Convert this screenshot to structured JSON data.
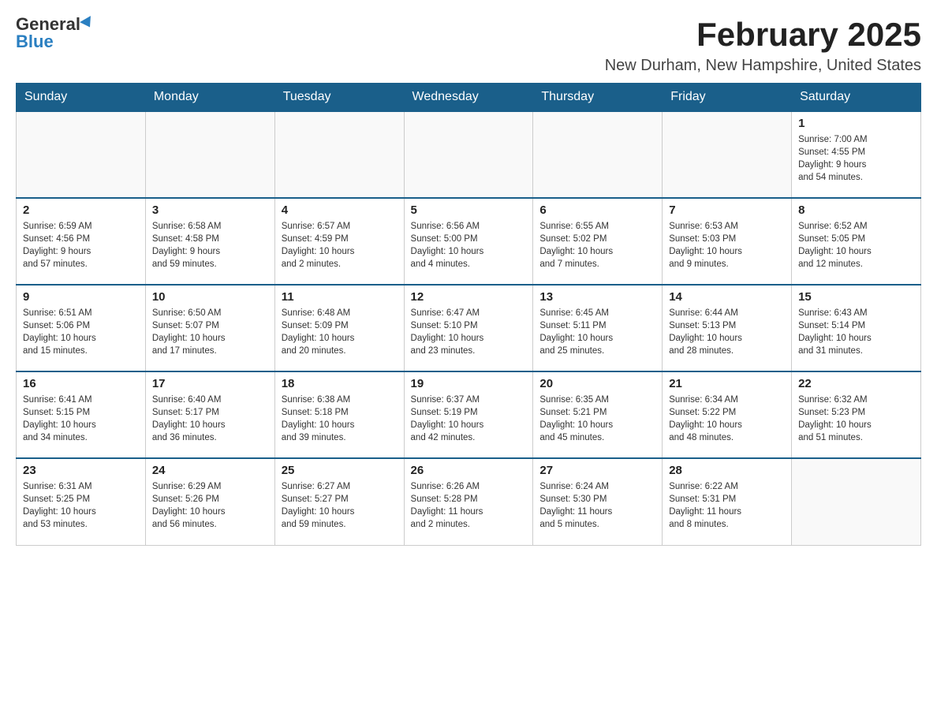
{
  "logo": {
    "general": "General",
    "blue": "Blue"
  },
  "title": "February 2025",
  "subtitle": "New Durham, New Hampshire, United States",
  "days_of_week": [
    "Sunday",
    "Monday",
    "Tuesday",
    "Wednesday",
    "Thursday",
    "Friday",
    "Saturday"
  ],
  "weeks": [
    {
      "days": [
        {
          "number": "",
          "info": "",
          "empty": true
        },
        {
          "number": "",
          "info": "",
          "empty": true
        },
        {
          "number": "",
          "info": "",
          "empty": true
        },
        {
          "number": "",
          "info": "",
          "empty": true
        },
        {
          "number": "",
          "info": "",
          "empty": true
        },
        {
          "number": "",
          "info": "",
          "empty": true
        },
        {
          "number": "1",
          "info": "Sunrise: 7:00 AM\nSunset: 4:55 PM\nDaylight: 9 hours\nand 54 minutes.",
          "empty": false
        }
      ]
    },
    {
      "days": [
        {
          "number": "2",
          "info": "Sunrise: 6:59 AM\nSunset: 4:56 PM\nDaylight: 9 hours\nand 57 minutes.",
          "empty": false
        },
        {
          "number": "3",
          "info": "Sunrise: 6:58 AM\nSunset: 4:58 PM\nDaylight: 9 hours\nand 59 minutes.",
          "empty": false
        },
        {
          "number": "4",
          "info": "Sunrise: 6:57 AM\nSunset: 4:59 PM\nDaylight: 10 hours\nand 2 minutes.",
          "empty": false
        },
        {
          "number": "5",
          "info": "Sunrise: 6:56 AM\nSunset: 5:00 PM\nDaylight: 10 hours\nand 4 minutes.",
          "empty": false
        },
        {
          "number": "6",
          "info": "Sunrise: 6:55 AM\nSunset: 5:02 PM\nDaylight: 10 hours\nand 7 minutes.",
          "empty": false
        },
        {
          "number": "7",
          "info": "Sunrise: 6:53 AM\nSunset: 5:03 PM\nDaylight: 10 hours\nand 9 minutes.",
          "empty": false
        },
        {
          "number": "8",
          "info": "Sunrise: 6:52 AM\nSunset: 5:05 PM\nDaylight: 10 hours\nand 12 minutes.",
          "empty": false
        }
      ]
    },
    {
      "days": [
        {
          "number": "9",
          "info": "Sunrise: 6:51 AM\nSunset: 5:06 PM\nDaylight: 10 hours\nand 15 minutes.",
          "empty": false
        },
        {
          "number": "10",
          "info": "Sunrise: 6:50 AM\nSunset: 5:07 PM\nDaylight: 10 hours\nand 17 minutes.",
          "empty": false
        },
        {
          "number": "11",
          "info": "Sunrise: 6:48 AM\nSunset: 5:09 PM\nDaylight: 10 hours\nand 20 minutes.",
          "empty": false
        },
        {
          "number": "12",
          "info": "Sunrise: 6:47 AM\nSunset: 5:10 PM\nDaylight: 10 hours\nand 23 minutes.",
          "empty": false
        },
        {
          "number": "13",
          "info": "Sunrise: 6:45 AM\nSunset: 5:11 PM\nDaylight: 10 hours\nand 25 minutes.",
          "empty": false
        },
        {
          "number": "14",
          "info": "Sunrise: 6:44 AM\nSunset: 5:13 PM\nDaylight: 10 hours\nand 28 minutes.",
          "empty": false
        },
        {
          "number": "15",
          "info": "Sunrise: 6:43 AM\nSunset: 5:14 PM\nDaylight: 10 hours\nand 31 minutes.",
          "empty": false
        }
      ]
    },
    {
      "days": [
        {
          "number": "16",
          "info": "Sunrise: 6:41 AM\nSunset: 5:15 PM\nDaylight: 10 hours\nand 34 minutes.",
          "empty": false
        },
        {
          "number": "17",
          "info": "Sunrise: 6:40 AM\nSunset: 5:17 PM\nDaylight: 10 hours\nand 36 minutes.",
          "empty": false
        },
        {
          "number": "18",
          "info": "Sunrise: 6:38 AM\nSunset: 5:18 PM\nDaylight: 10 hours\nand 39 minutes.",
          "empty": false
        },
        {
          "number": "19",
          "info": "Sunrise: 6:37 AM\nSunset: 5:19 PM\nDaylight: 10 hours\nand 42 minutes.",
          "empty": false
        },
        {
          "number": "20",
          "info": "Sunrise: 6:35 AM\nSunset: 5:21 PM\nDaylight: 10 hours\nand 45 minutes.",
          "empty": false
        },
        {
          "number": "21",
          "info": "Sunrise: 6:34 AM\nSunset: 5:22 PM\nDaylight: 10 hours\nand 48 minutes.",
          "empty": false
        },
        {
          "number": "22",
          "info": "Sunrise: 6:32 AM\nSunset: 5:23 PM\nDaylight: 10 hours\nand 51 minutes.",
          "empty": false
        }
      ]
    },
    {
      "days": [
        {
          "number": "23",
          "info": "Sunrise: 6:31 AM\nSunset: 5:25 PM\nDaylight: 10 hours\nand 53 minutes.",
          "empty": false
        },
        {
          "number": "24",
          "info": "Sunrise: 6:29 AM\nSunset: 5:26 PM\nDaylight: 10 hours\nand 56 minutes.",
          "empty": false
        },
        {
          "number": "25",
          "info": "Sunrise: 6:27 AM\nSunset: 5:27 PM\nDaylight: 10 hours\nand 59 minutes.",
          "empty": false
        },
        {
          "number": "26",
          "info": "Sunrise: 6:26 AM\nSunset: 5:28 PM\nDaylight: 11 hours\nand 2 minutes.",
          "empty": false
        },
        {
          "number": "27",
          "info": "Sunrise: 6:24 AM\nSunset: 5:30 PM\nDaylight: 11 hours\nand 5 minutes.",
          "empty": false
        },
        {
          "number": "28",
          "info": "Sunrise: 6:22 AM\nSunset: 5:31 PM\nDaylight: 11 hours\nand 8 minutes.",
          "empty": false
        },
        {
          "number": "",
          "info": "",
          "empty": true
        }
      ]
    }
  ]
}
